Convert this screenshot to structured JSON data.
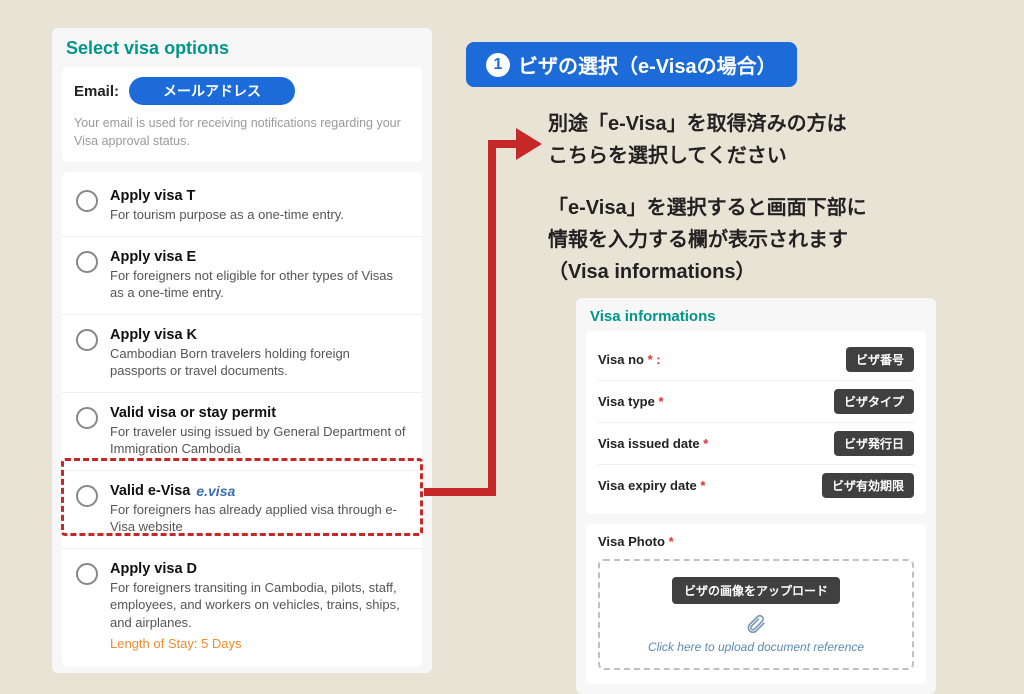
{
  "left": {
    "title": "Select visa options",
    "email_label": "Email:",
    "email_pill": "メールアドレス",
    "email_note": "Your email is used for receiving notifications regarding your Visa approval status.",
    "options": [
      {
        "title": "Apply visa T",
        "desc": "For tourism purpose as a one-time entry."
      },
      {
        "title": "Apply visa E",
        "desc": "For foreigners not eligible for other types of Visas as a one-time entry."
      },
      {
        "title": "Apply visa K",
        "desc": "Cambodian Born travelers holding foreign passports or travel documents."
      },
      {
        "title": "Valid visa or stay permit",
        "desc": "For traveler using issued by General Department of Immigration Cambodia"
      },
      {
        "title": "Valid e-Visa",
        "logo": "e.visa",
        "desc": "For foreigners has already applied visa through e-Visa website"
      },
      {
        "title": "Apply visa D",
        "desc": "For foreigners transiting in Cambodia, pilots, staff, employees, and workers on vehicles, trains, ships, and airplanes.",
        "extra": "Length of Stay: 5 Days"
      }
    ]
  },
  "right": {
    "badge_num": "1",
    "badge_text": "ビザの選択（e-Visaの場合）",
    "anno1_line1": "別途「e-Visa」を取得済みの方は",
    "anno1_line2": "こちらを選択してください",
    "anno2_line1": "「e-Visa」を選択すると画面下部に",
    "anno2_line2": "情報を入力する欄が表示されます",
    "anno2_line3": "（Visa informations）"
  },
  "visa": {
    "title": "Visa informations",
    "rows": [
      {
        "label": "Visa no",
        "star": "* :",
        "tag": "ビザ番号"
      },
      {
        "label": "Visa type",
        "star": "*",
        "tag": "ビザタイプ"
      },
      {
        "label": "Visa issued date",
        "star": "*",
        "tag": "ビザ発行日"
      },
      {
        "label": "Visa expiry date",
        "star": "*",
        "tag": "ビザ有効期限"
      }
    ],
    "photo_label": "Visa Photo",
    "photo_star": "*",
    "upload_tag": "ビザの画像をアップロード",
    "upload_link": "Click here to upload document reference"
  }
}
